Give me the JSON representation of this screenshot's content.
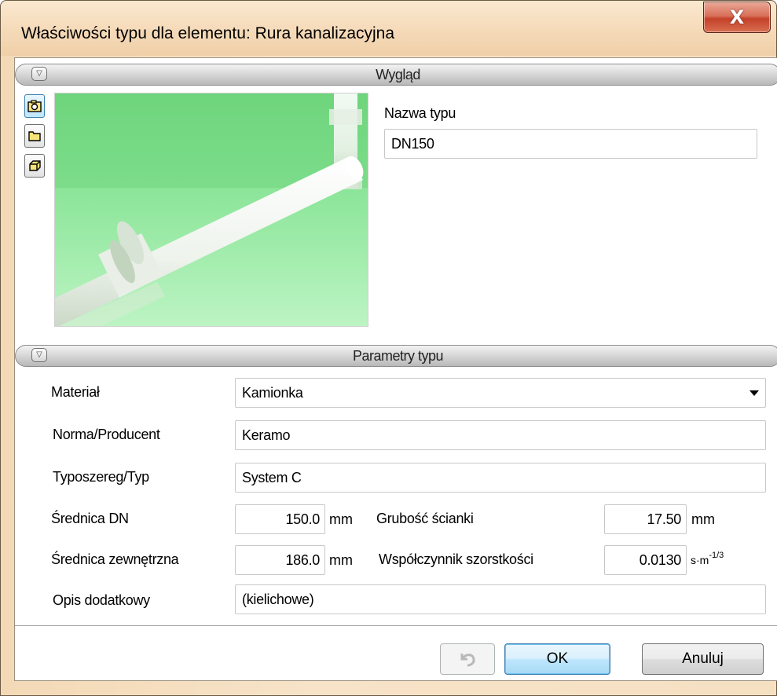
{
  "window": {
    "title": "Właściwości typu dla elementu: Rura kanalizacyjna",
    "close_glyph": "X"
  },
  "appearance": {
    "section_title": "Wygląd",
    "toggle_glyph": "▽",
    "view_buttons": [
      {
        "icon": "camera-icon"
      },
      {
        "icon": "folder-icon"
      },
      {
        "icon": "3d-box-icon"
      }
    ],
    "type_name_label": "Nazwa typu",
    "type_name_value": "DN150"
  },
  "params": {
    "section_title": "Parametry typu",
    "toggle_glyph": "▽",
    "material_label": "Materiał",
    "material_value": "Kamionka",
    "norm_label": "Norma/Producent",
    "norm_value": "Keramo",
    "series_label": "Typoszereg/Typ",
    "series_value": "System C",
    "dn_label": "Średnica DN",
    "dn_value": "150.0",
    "dn_unit": "mm",
    "wall_label": "Grubość ścianki",
    "wall_value": "17.50",
    "wall_unit": "mm",
    "outer_label": "Średnica zewnętrzna",
    "outer_value": "186.0",
    "outer_unit": "mm",
    "rough_label": "Współczynnik szorstkości",
    "rough_value": "0.0130",
    "rough_unit_base": "s·m",
    "rough_unit_exp": "-1/3",
    "desc_label": "Opis dodatkowy",
    "desc_value": "(kielichowe)"
  },
  "buttons": {
    "ok": "OK",
    "cancel": "Anuluj"
  },
  "colors": {
    "preview_bg": "#8fe39a",
    "pipe": "#f2f4f0"
  }
}
